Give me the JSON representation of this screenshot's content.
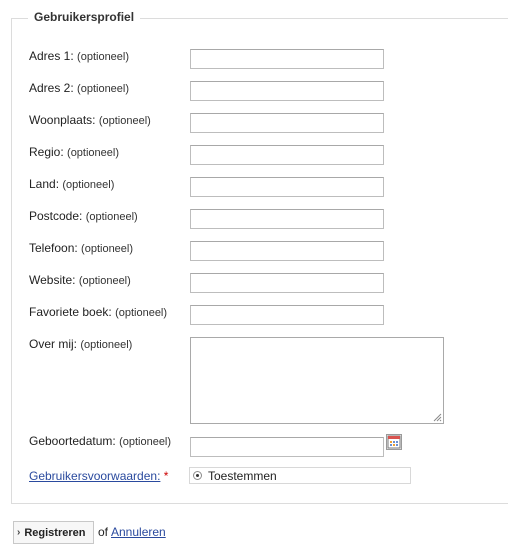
{
  "fieldset": {
    "legend": "Gebruikersprofiel"
  },
  "fields": [
    {
      "label": "Adres 1:",
      "optional": "(optioneel)",
      "value": ""
    },
    {
      "label": "Adres 2:",
      "optional": "(optioneel)",
      "value": ""
    },
    {
      "label": "Woonplaats:",
      "optional": "(optioneel)",
      "value": ""
    },
    {
      "label": "Regio:",
      "optional": "(optioneel)",
      "value": ""
    },
    {
      "label": "Land:",
      "optional": "(optioneel)",
      "value": ""
    },
    {
      "label": "Postcode:",
      "optional": "(optioneel)",
      "value": ""
    },
    {
      "label": "Telefoon:",
      "optional": "(optioneel)",
      "value": ""
    },
    {
      "label": "Website:",
      "optional": "(optioneel)",
      "value": ""
    },
    {
      "label": "Favoriete boek:",
      "optional": "(optioneel)",
      "value": ""
    }
  ],
  "about": {
    "label": "Over mij:",
    "optional": "(optioneel)",
    "value": ""
  },
  "birthdate": {
    "label": "Geboortedatum:",
    "optional": "(optioneel)",
    "value": "",
    "icon": "calendar-icon"
  },
  "terms": {
    "link_label": "Gebruikersvoorwaarden:",
    "required_mark": "*",
    "option_label": "Toestemmen",
    "selected": true
  },
  "actions": {
    "submit_label": "Registreren",
    "submit_icon": "chevron-right-icon",
    "or_text": "of",
    "cancel_label": "Annuleren"
  },
  "colors": {
    "link": "#2a4a9e",
    "required": "#cc0000"
  }
}
